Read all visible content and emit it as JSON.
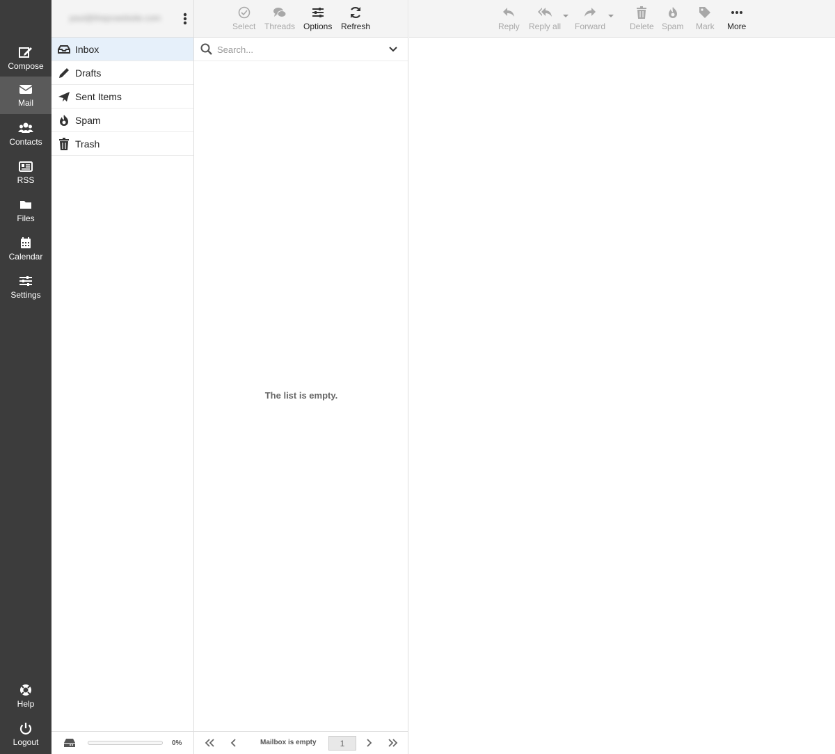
{
  "nav": {
    "compose": "Compose",
    "mail": "Mail",
    "contacts": "Contacts",
    "rss": "RSS",
    "files": "Files",
    "calendar": "Calendar",
    "settings": "Settings",
    "help": "Help",
    "logout": "Logout"
  },
  "account": {
    "email": "paul@thepcwebsite.com"
  },
  "folders": [
    {
      "name": "Inbox",
      "icon": "inbox-icon"
    },
    {
      "name": "Drafts",
      "icon": "pencil-icon"
    },
    {
      "name": "Sent Items",
      "icon": "paper-plane-icon"
    },
    {
      "name": "Spam",
      "icon": "fire-icon"
    },
    {
      "name": "Trash",
      "icon": "trash-icon"
    }
  ],
  "quota": {
    "percent_label": "0%",
    "used_fraction": 0
  },
  "list_toolbar": {
    "select": "Select",
    "threads": "Threads",
    "options": "Options",
    "refresh": "Refresh"
  },
  "search": {
    "placeholder": "Search..."
  },
  "list": {
    "empty_message": "The list is empty."
  },
  "pager": {
    "status": "Mailbox is empty",
    "page": "1"
  },
  "preview_toolbar": {
    "reply": "Reply",
    "reply_all": "Reply all",
    "forward": "Forward",
    "delete": "Delete",
    "spam": "Spam",
    "mark": "Mark",
    "more": "More"
  },
  "colors": {
    "nav_bg": "#3c3c3c",
    "nav_active": "#5a5a5a",
    "selected_folder": "#e6f0fa",
    "toolbar_bg": "#f4f4f4",
    "disabled_text": "#a8a8a8"
  }
}
